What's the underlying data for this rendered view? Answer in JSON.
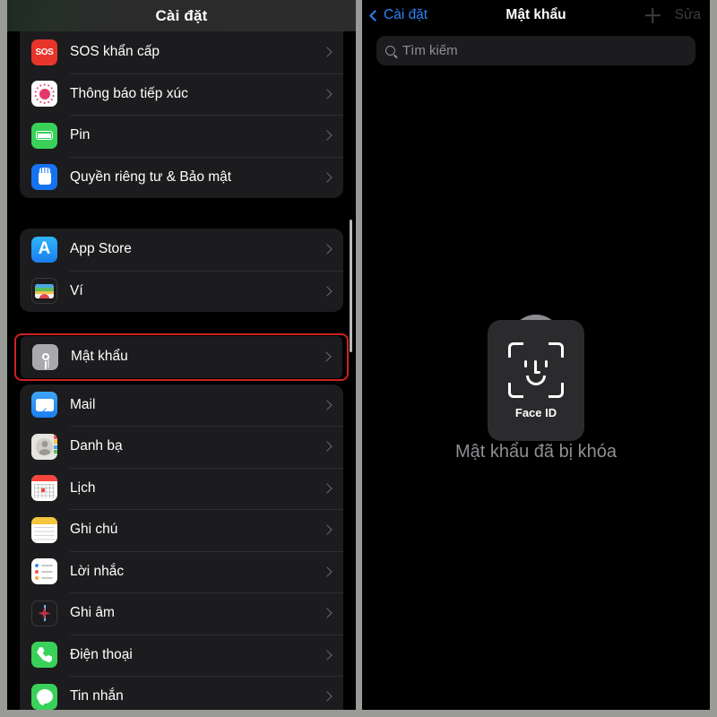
{
  "left_panel": {
    "header_title": "Cài đặt",
    "groups": [
      {
        "id": "group-system",
        "rows": [
          {
            "label": "SOS khẩn cấp",
            "icon": "sos-icon"
          },
          {
            "label": "Thông báo tiếp xúc",
            "icon": "exposure-notification-icon"
          },
          {
            "label": "Pin",
            "icon": "battery-icon"
          },
          {
            "label": "Quyền riêng tư & Bảo mật",
            "icon": "privacy-hand-icon"
          }
        ]
      },
      {
        "id": "group-store",
        "rows": [
          {
            "label": "App Store",
            "icon": "app-store-icon"
          },
          {
            "label": "Ví",
            "icon": "wallet-icon"
          }
        ]
      },
      {
        "id": "group-passwords",
        "highlighted": true,
        "rows": [
          {
            "label": "Mật khẩu",
            "icon": "key-icon"
          }
        ]
      },
      {
        "id": "group-apps",
        "rows": [
          {
            "label": "Mail",
            "icon": "mail-icon"
          },
          {
            "label": "Danh bạ",
            "icon": "contacts-icon"
          },
          {
            "label": "Lịch",
            "icon": "calendar-icon"
          },
          {
            "label": "Ghi chú",
            "icon": "notes-icon"
          },
          {
            "label": "Lời nhắc",
            "icon": "reminders-icon"
          },
          {
            "label": "Ghi âm",
            "icon": "voice-memos-icon"
          },
          {
            "label": "Điện thoại",
            "icon": "phone-icon"
          },
          {
            "label": "Tin nhắn",
            "icon": "messages-icon"
          }
        ]
      }
    ],
    "highlight_color": "#cc2222"
  },
  "right_panel": {
    "back_label": "Cài đặt",
    "title": "Mật khẩu",
    "add_icon": "plus-icon",
    "edit_label": "Sửa",
    "search": {
      "placeholder": "Tìm kiếm",
      "value": "",
      "icon": "search-icon"
    },
    "locked": {
      "icon": "lock-icon",
      "message": "Mật khẩu đã bị khóa",
      "faceid_label": "Face ID",
      "faceid_icon": "face-id-icon"
    },
    "accent_color": "#2f82f6"
  }
}
